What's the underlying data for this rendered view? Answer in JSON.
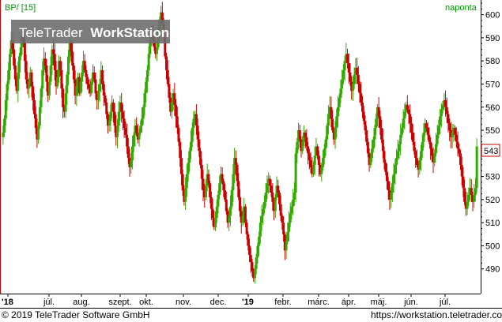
{
  "header": {
    "symbol_label": "BP/ [15]",
    "period_label": "naponta"
  },
  "watermark": {
    "brand_text": "TeleTrader",
    "product_text": "WorkStation"
  },
  "price_badge": "543",
  "footer": {
    "copyright": "© 2019 TeleTrader Software GmbH",
    "url": "https://workstation.teletrader.com"
  },
  "colors": {
    "up": "#33aa00",
    "down": "#cc0000",
    "header_text": "#009900",
    "badge_border": "#cc0000",
    "watermark_bg": "#6e6e6e"
  },
  "chart_data": {
    "type": "candlestick",
    "title": "BP/ [15]",
    "interval": "naponta",
    "ylim": [
      480,
      605
    ],
    "y_ticks": [
      490,
      500,
      510,
      520,
      530,
      540,
      550,
      560,
      570,
      580,
      590,
      600
    ],
    "x_tick_labels": [
      "'18",
      "júl.",
      "aug.",
      "szept.",
      "okt.",
      "nov.",
      "dec.",
      "'19",
      "febr.",
      "márc.",
      "ápr.",
      "máj.",
      "jún.",
      "júl."
    ],
    "last_price": 543,
    "grid": false,
    "series": [
      {
        "close": [
          549,
          555,
          563,
          570,
          576,
          583,
          589,
          585,
          578,
          572,
          567,
          575,
          582,
          586,
          591,
          588,
          580,
          572,
          568,
          571,
          575,
          569,
          563,
          557,
          551,
          546,
          552,
          560,
          568,
          576,
          581,
          578,
          571,
          565,
          571,
          578,
          585,
          583,
          576,
          569,
          573,
          580,
          576,
          568,
          560,
          558,
          566,
          574,
          582,
          588,
          584,
          578,
          572,
          565,
          569,
          573,
          566,
          571,
          575,
          580,
          576,
          573,
          570,
          568,
          566,
          571,
          575,
          572,
          566,
          563,
          567,
          570,
          576,
          570,
          565,
          562,
          557,
          552,
          554,
          558,
          562,
          558,
          552,
          547,
          552,
          558,
          562,
          558,
          555,
          551,
          548,
          543,
          538,
          534,
          537,
          543,
          548,
          552,
          549,
          546,
          549,
          552,
          555,
          560,
          566,
          571,
          576,
          583,
          589,
          591,
          590,
          586,
          583,
          586,
          593,
          598,
          601,
          596,
          590,
          582,
          576,
          570,
          564,
          558,
          562,
          566,
          561,
          556,
          551,
          545,
          538,
          531,
          524,
          519,
          525,
          531,
          536,
          541,
          545,
          551,
          555,
          557,
          552,
          546,
          541,
          535,
          529,
          524,
          521,
          526,
          531,
          527,
          521,
          516,
          512,
          508,
          512,
          517,
          522,
          527,
          531,
          528,
          524,
          520,
          515,
          510,
          513,
          517,
          524,
          531,
          538,
          535,
          528,
          521,
          515,
          510,
          513,
          517,
          510,
          505,
          500,
          496,
          493,
          489,
          486,
          490,
          495,
          500,
          504,
          510,
          513,
          516,
          519,
          523,
          527,
          529,
          526,
          523,
          519,
          515,
          521,
          526,
          523,
          518,
          513,
          510,
          505,
          498,
          502,
          506,
          510,
          514,
          517,
          520,
          523,
          540,
          545,
          550,
          546,
          541,
          545,
          549,
          547,
          543,
          540,
          537,
          534,
          531,
          535,
          539,
          543,
          539,
          535,
          531,
          534,
          538,
          542,
          546,
          552,
          557,
          560,
          555,
          550,
          546,
          551,
          556,
          560,
          564,
          568,
          572,
          576,
          580,
          583,
          579,
          575,
          571,
          567,
          570,
          574,
          577,
          574,
          570,
          566,
          562,
          558,
          554,
          550,
          545,
          540,
          535,
          538,
          542,
          546,
          551,
          555,
          560,
          556,
          551,
          546,
          541,
          536,
          532,
          528,
          524,
          520,
          523,
          527,
          531,
          535,
          538,
          541,
          544,
          548,
          551,
          555,
          558,
          561,
          559,
          557,
          553,
          549,
          545,
          541,
          538,
          535,
          533,
          537,
          541,
          545,
          549,
          553,
          551,
          548,
          545,
          542,
          539,
          536,
          540,
          544,
          548,
          552,
          556,
          559,
          561,
          563,
          560,
          557,
          553,
          550,
          547,
          549,
          551,
          548,
          545,
          542,
          540,
          535,
          530,
          525,
          519,
          516,
          519,
          522,
          525,
          522,
          519,
          522,
          525,
          543
        ]
      }
    ]
  }
}
